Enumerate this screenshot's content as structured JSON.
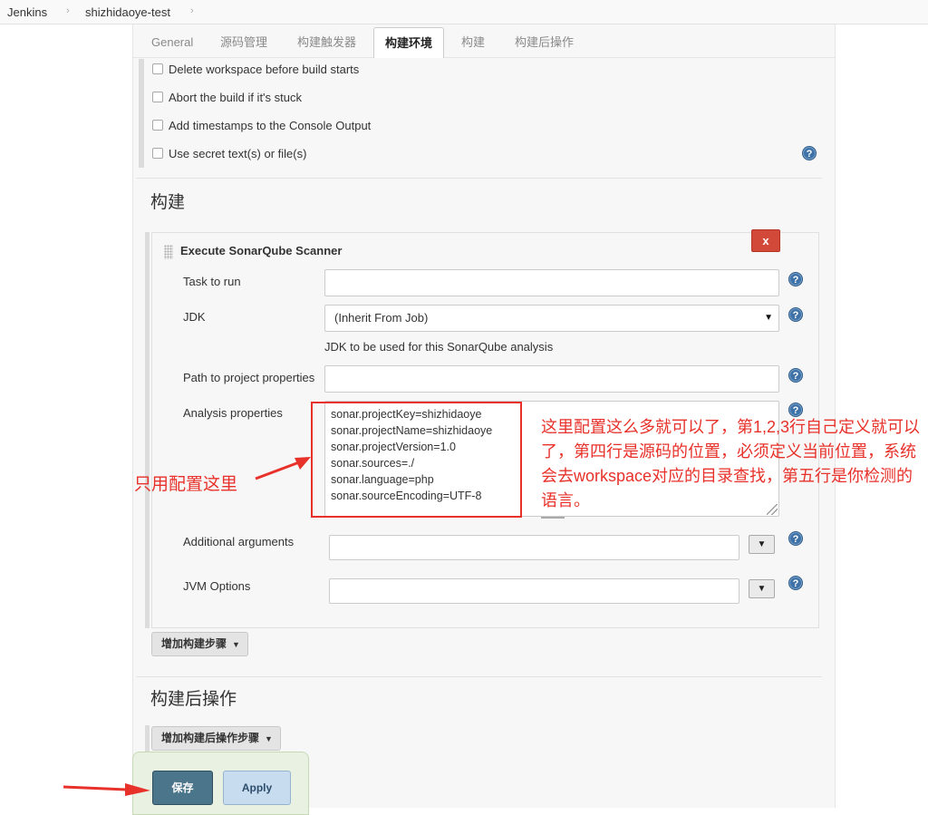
{
  "breadcrumb": {
    "items": [
      "Jenkins",
      "shizhidaoye-test"
    ],
    "separator": "›"
  },
  "tabs": [
    {
      "label": "General"
    },
    {
      "label": "源码管理"
    },
    {
      "label": "构建触发器"
    },
    {
      "label": "构建环境",
      "active": true
    },
    {
      "label": "构建"
    },
    {
      "label": "构建后操作"
    }
  ],
  "build_env": {
    "options": [
      {
        "label": "Delete workspace before build starts",
        "checked": false
      },
      {
        "label": "Abort the build if it's stuck",
        "checked": false
      },
      {
        "label": "Add timestamps to the Console Output",
        "checked": false
      },
      {
        "label": "Use secret text(s) or file(s)",
        "checked": false
      }
    ]
  },
  "build": {
    "title": "构建",
    "step": {
      "title": "Execute SonarQube Scanner",
      "delete_label": "x",
      "task_label": "Task to run",
      "task_value": "",
      "jdk_label": "JDK",
      "jdk_value": "(Inherit From Job)",
      "jdk_hint": "JDK to be used for this SonarQube analysis",
      "path_label": "Path to project properties",
      "path_value": "",
      "analysis_label": "Analysis properties",
      "analysis_lines": [
        "sonar.projectKey=shizhidaoye",
        "sonar.projectName=shizhidaoye",
        "sonar.projectVersion=1.0",
        "sonar.sources=./",
        "sonar.language=php",
        "sonar.sourceEncoding=UTF-8"
      ],
      "additional_label": "Additional arguments",
      "additional_value": "",
      "jvm_label": "JVM Options",
      "jvm_value": ""
    },
    "add_step_label": "增加构建步骤"
  },
  "post_build": {
    "title": "构建后操作",
    "add_step_label": "增加构建后操作步骤"
  },
  "actions": {
    "save_label": "保存",
    "apply_label": "Apply"
  },
  "annotations": {
    "main_note": "这里配置这么多就可以了，第1,2,3行自己定义就可以了，第四行是源码的位置，必须定义当前位置，系统会去workspace对应的目录查找，第五行是你检测的语言。",
    "left_note": "只用配置这里",
    "color": "#e8312a"
  },
  "icons": {
    "help": "?",
    "dropdown": "▼"
  }
}
